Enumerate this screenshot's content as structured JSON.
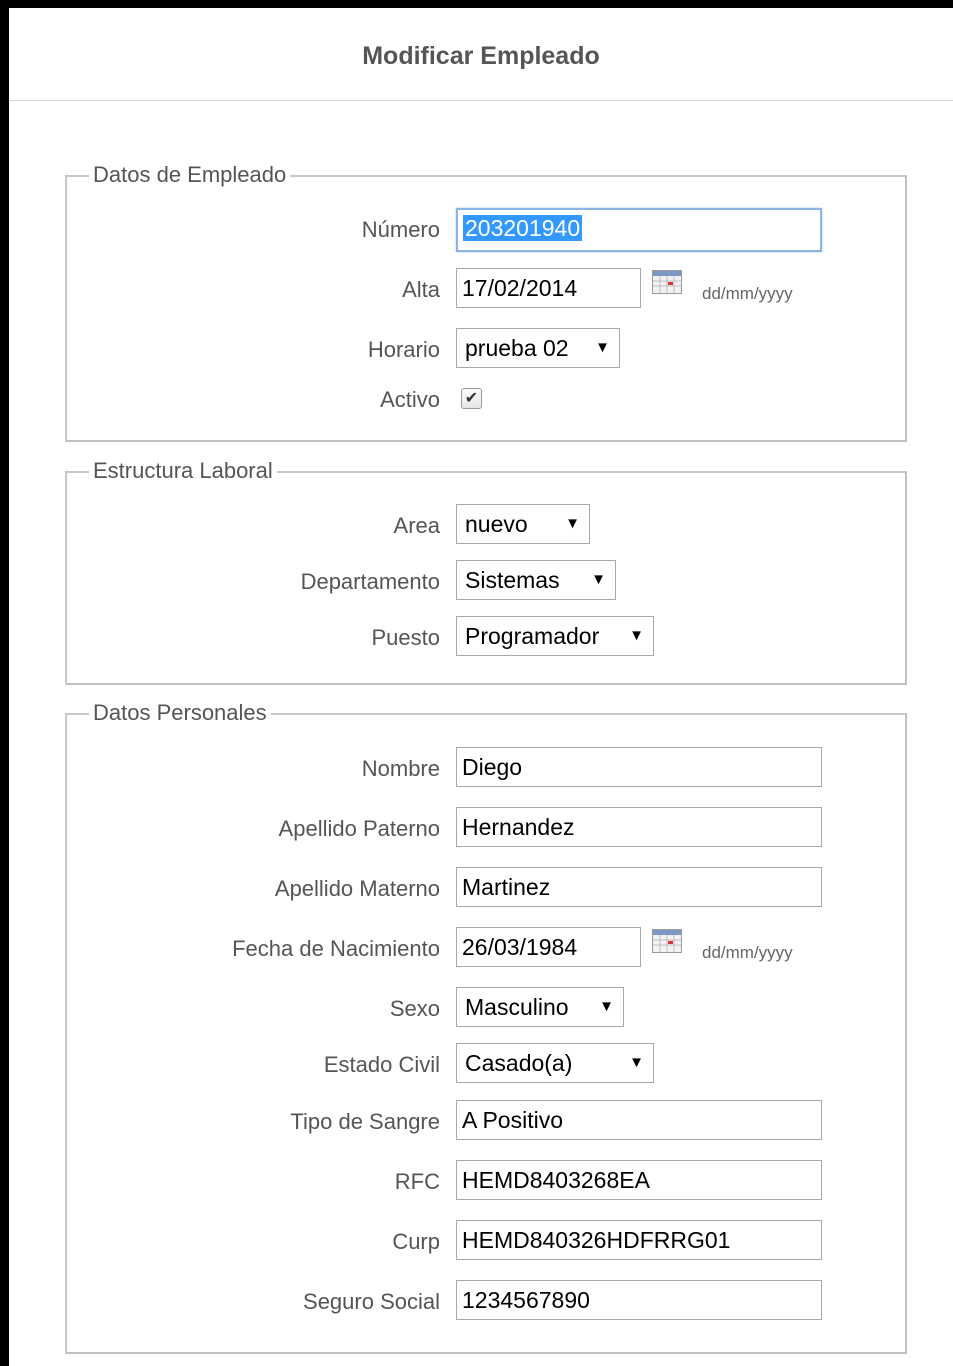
{
  "header": {
    "title": "Modificar Empleado"
  },
  "datos_empleado": {
    "legend": "Datos de Empleado",
    "numero": {
      "label": "Número",
      "value": "203201940"
    },
    "alta": {
      "label": "Alta",
      "value": "17/02/2014",
      "format": "dd/mm/yyyy",
      "icon": "calendar-icon"
    },
    "horario": {
      "label": "Horario",
      "selected": "prueba 02"
    },
    "activo": {
      "label": "Activo",
      "checked": true,
      "check": "✔"
    }
  },
  "estructura_laboral": {
    "legend": "Estructura Laboral",
    "area": {
      "label": "Area",
      "selected": "nuevo"
    },
    "departamento": {
      "label": "Departamento",
      "selected": "Sistemas"
    },
    "puesto": {
      "label": "Puesto",
      "selected": "Programador"
    }
  },
  "datos_personales": {
    "legend": "Datos Personales",
    "nombre": {
      "label": "Nombre",
      "value": "Diego"
    },
    "apellido_paterno": {
      "label": "Apellido Paterno",
      "value": "Hernandez"
    },
    "apellido_materno": {
      "label": "Apellido Materno",
      "value": "Martinez"
    },
    "fecha_nacimiento": {
      "label": "Fecha de Nacimiento",
      "value": "26/03/1984",
      "format": "dd/mm/yyyy",
      "icon": "calendar-icon"
    },
    "sexo": {
      "label": "Sexo",
      "selected": "Masculino"
    },
    "estado_civil": {
      "label": "Estado Civil",
      "selected": "Casado(a)"
    },
    "tipo_sangre": {
      "label": "Tipo de Sangre",
      "value": "A Positivo"
    },
    "rfc": {
      "label": "RFC",
      "value": "HEMD8403268EA"
    },
    "curp": {
      "label": "Curp",
      "value": "HEMD840326HDFRRG01"
    },
    "seguro_social": {
      "label": "Seguro Social",
      "value": "1234567890"
    }
  },
  "colors": {
    "focus_border": "#8db2e3",
    "selection": "#3399ff",
    "text": "#555555"
  }
}
